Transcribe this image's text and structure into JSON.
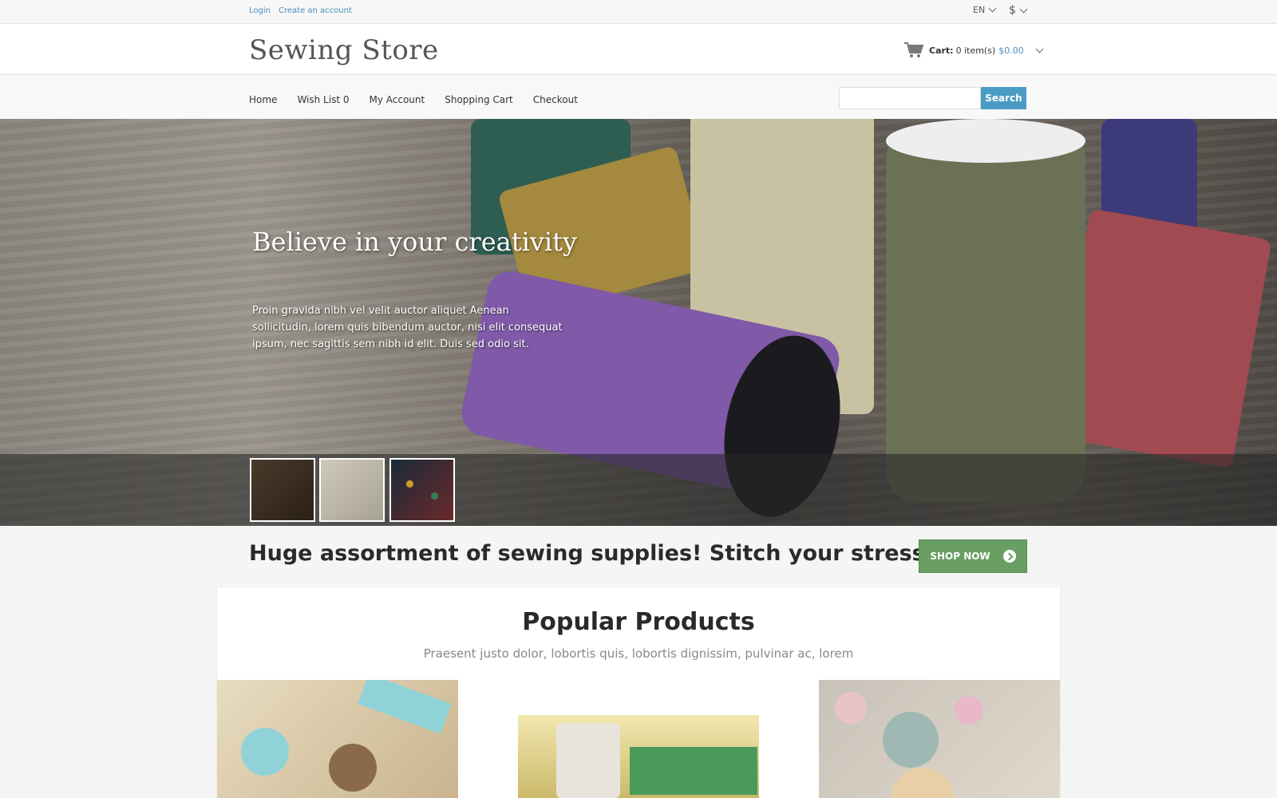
{
  "topbar": {
    "login": "Login",
    "create_account": "Create an account",
    "language": "EN",
    "currency": "$"
  },
  "header": {
    "store_name": "Sewing Store",
    "cart_label": "Cart:",
    "cart_items": "0 item(s)",
    "cart_total": "$0.00"
  },
  "nav": {
    "items": [
      "Home",
      "Wish List 0",
      "My Account",
      "Shopping Cart",
      "Checkout"
    ],
    "search_button": "Search",
    "search_value": ""
  },
  "hero": {
    "title": "Believe in your creativity",
    "text": "Proin gravida nibh vel velit auctor aliquet Aenean sollicitudin, lorem quis bibendum auctor, nisi elit consequat ipsum, nec sagittis sem nibh id elit. Duis sed odio sit."
  },
  "promo": {
    "text": "Huge assortment of sewing supplies! Stitch your stress away.",
    "button": "SHOP NOW"
  },
  "popular": {
    "title": "Popular Products",
    "subtitle": "Praesent justo dolor, lobortis quis, lobortis dignissim, pulvinar ac, lorem"
  },
  "colors": {
    "accent": "#4a9cc4",
    "link": "#4a8fbd",
    "shop_button": "#6a9f64"
  }
}
